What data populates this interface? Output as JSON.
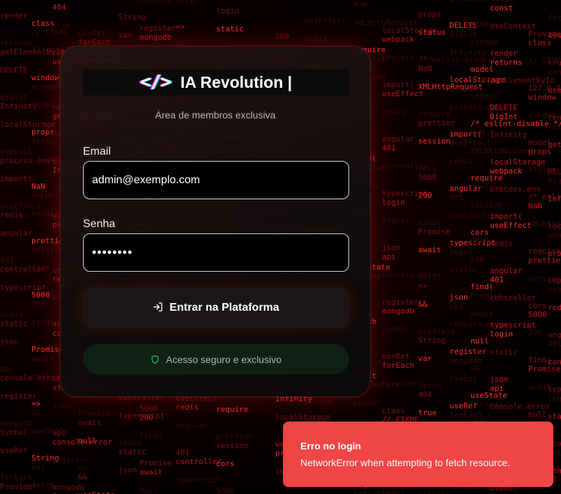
{
  "brand": {
    "logo_icon": "</>",
    "title": "IA Revolution |",
    "subtitle": "Área de membros exclusiva"
  },
  "form": {
    "email_label": "Email",
    "email_value": "admin@exemplo.com",
    "password_label": "Senha",
    "password_value": "••••••••",
    "submit_label": "Entrar na Plataforma",
    "submit_icon": "login-icon",
    "secure_text": "Acesso seguro e exclusivo",
    "secure_icon": "shield-icon"
  },
  "toast": {
    "title": "Erro no login",
    "message": "NetworkError when attempting to fetch resource."
  },
  "colors": {
    "accent_red": "#ef4545",
    "background": "#050000",
    "code_red": "#c0141a",
    "badge_green": "#0f2017",
    "shield_green": "#22c55e"
  },
  "background_code": [
    "useContext",
    "render",
    "returns",
    "getElementById",
    "DELETE",
    "BigInt",
    "Infinity",
    "localStorage",
    "webpack",
    "process.env",
    "import(",
    "useEffect",
    "redis",
    "angular",
    "401",
    "controller",
    "typescript",
    "login",
    "static",
    "json",
    "api",
    "console.error",
    "register",
    "mongodb",
    "Symbol",
    "useRef",
    "forEach",
    "Provider",
    "class",
    "// FIXME",
    "127.0.0.1",
    "window",
    "schema",
    "model",
    "props",
    "status",
    "/* eslint-disable */",
    "NaN",
    "XMLHttpRequest",
    "require",
    "prettier",
    "session",
    "cors",
    "5000",
    "200",
    "find(",
    "Promise",
    "await",
    "null",
    "=>",
    "&&",
    "useState",
    "String",
    "var",
    "fetch",
    "404",
    "true",
    "const"
  ]
}
